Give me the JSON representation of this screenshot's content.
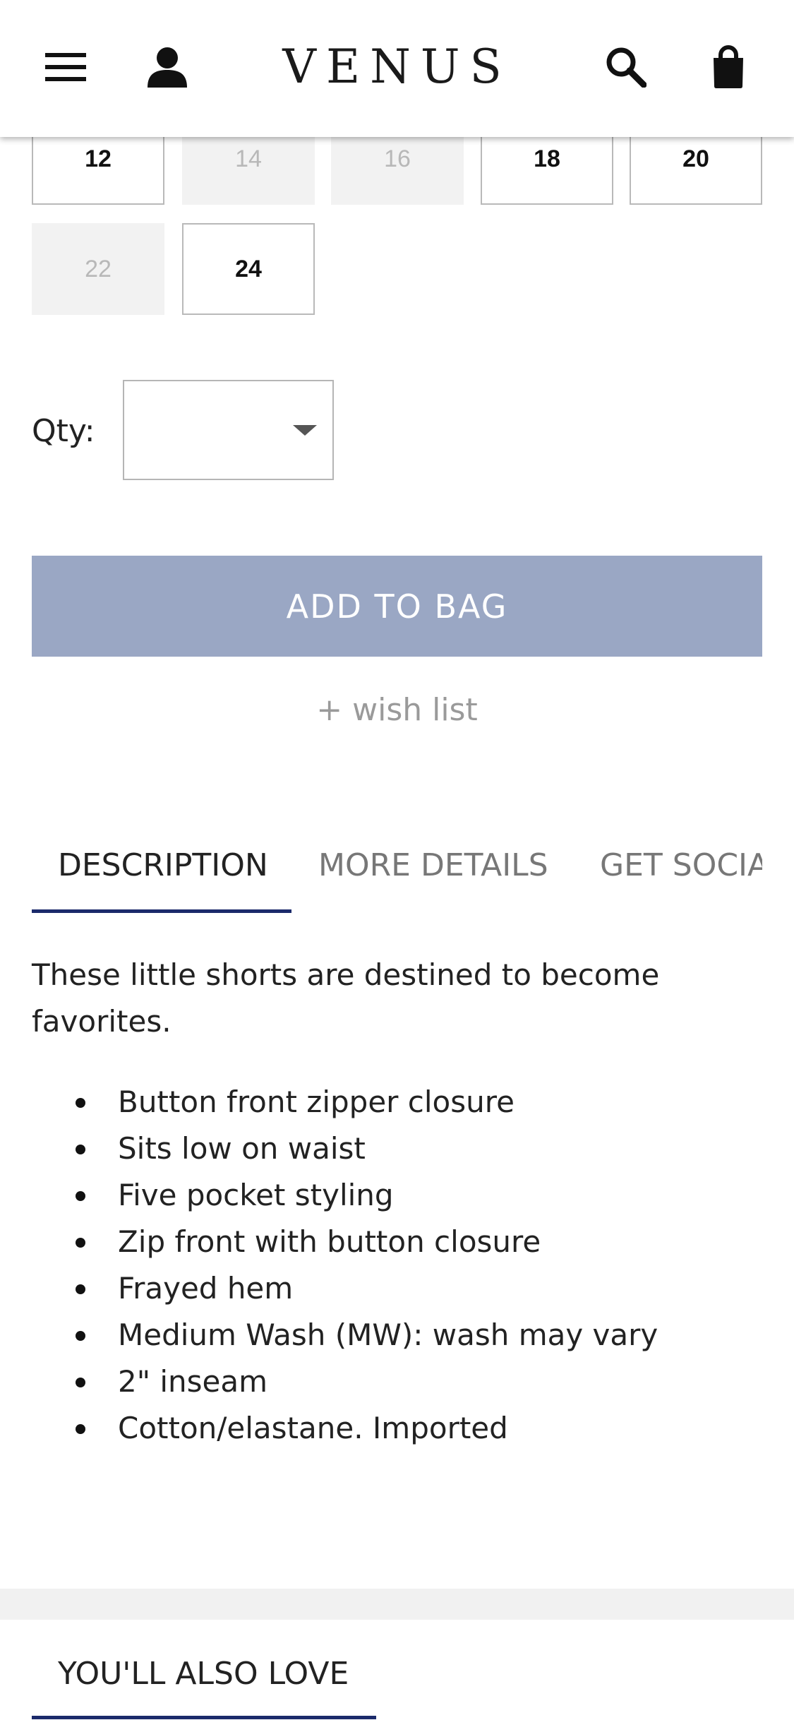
{
  "header": {
    "logo": "VENUS",
    "icons": [
      "menu-icon",
      "account-icon",
      "search-icon",
      "shopping-bag-icon"
    ]
  },
  "sizes": [
    {
      "label": "12",
      "available": true
    },
    {
      "label": "14",
      "available": false
    },
    {
      "label": "16",
      "available": false
    },
    {
      "label": "18",
      "available": true
    },
    {
      "label": "20",
      "available": true
    },
    {
      "label": "22",
      "available": false
    },
    {
      "label": "24",
      "available": true
    }
  ],
  "quantity": {
    "label": "Qty:",
    "value": ""
  },
  "actions": {
    "add_to_bag": "ADD TO BAG",
    "wish_list": "+ wish list"
  },
  "tabs": [
    {
      "label": "DESCRIPTION",
      "active": true
    },
    {
      "label": "MORE DETAILS",
      "active": false
    },
    {
      "label": "GET SOCIAL",
      "active": false
    }
  ],
  "description": {
    "intro": "These little shorts are destined to become favorites.",
    "bullets": [
      "Button front zipper closure",
      "Sits low on waist",
      "Five pocket styling",
      "Zip front with button closure",
      "Frayed hem",
      "Medium Wash (MW): wash may vary",
      "2\" inseam",
      "Cotton/elastane. Imported"
    ]
  },
  "recommendations": {
    "title": "YOU'LL ALSO LOVE"
  },
  "colors": {
    "add_to_bag_bg": "#9aa7c4",
    "accent_underline": "#1b2a6b",
    "disabled_bg": "#f2f2f2"
  }
}
